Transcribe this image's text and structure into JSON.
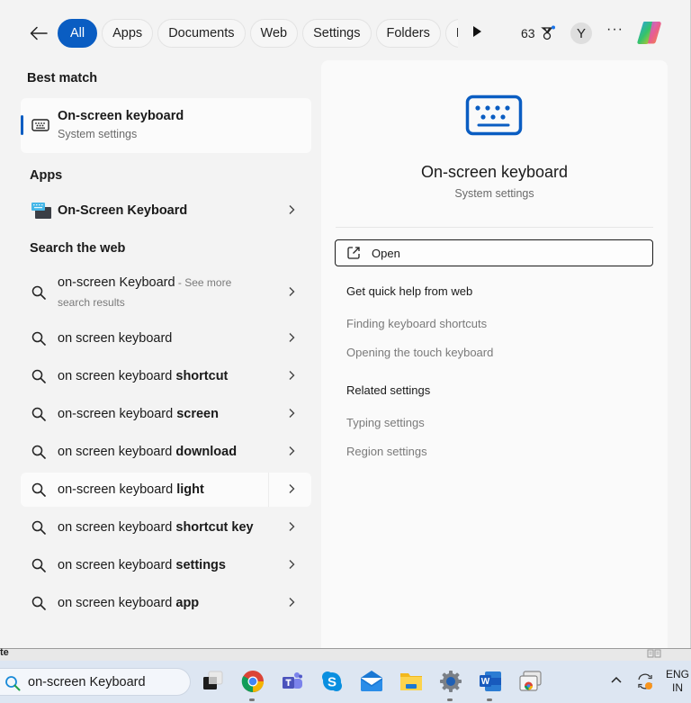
{
  "topbar": {
    "filters": [
      {
        "label": "All",
        "active": true
      },
      {
        "label": "Apps"
      },
      {
        "label": "Documents"
      },
      {
        "label": "Web"
      },
      {
        "label": "Settings"
      },
      {
        "label": "Folders"
      },
      {
        "label": "Photos"
      }
    ],
    "filters_visible_last": "Pho",
    "rewards_points": "63",
    "avatar_initial": "Y",
    "more_label": "···"
  },
  "left": {
    "best_match_title": "Best match",
    "best_match": {
      "title": "On-screen keyboard",
      "subtitle": "System settings"
    },
    "apps_title": "Apps",
    "apps": [
      {
        "label": "On-Screen Keyboard"
      }
    ],
    "web_title": "Search the web",
    "web_first": {
      "query": "on-screen Keyboard",
      "suffix": " - See more",
      "subline": "search results"
    },
    "web_suggestions": [
      {
        "prefix": "on screen keyboard",
        "bold": ""
      },
      {
        "prefix": "on screen keyboard ",
        "bold": "shortcut"
      },
      {
        "prefix": "on-screen keyboard ",
        "bold": "screen"
      },
      {
        "prefix": "on screen keyboard ",
        "bold": "download"
      },
      {
        "prefix": "on-screen keyboard ",
        "bold": "light"
      },
      {
        "prefix": "on screen keyboard ",
        "bold": "shortcut key"
      },
      {
        "prefix": "on screen keyboard ",
        "bold": "settings"
      },
      {
        "prefix": "on screen keyboard ",
        "bold": "app"
      }
    ]
  },
  "right": {
    "title": "On-screen keyboard",
    "subtitle": "System settings",
    "open_label": "Open",
    "help_title": "Get quick help from web",
    "help_links": [
      "Finding keyboard shortcuts",
      "Opening the touch keyboard"
    ],
    "related_title": "Related settings",
    "related_links": [
      "Typing settings",
      "Region settings"
    ]
  },
  "background": {
    "fragment": "te"
  },
  "taskbar": {
    "search_value": "on-screen Keyboard",
    "apps": [
      "Task View",
      "Google Chrome",
      "Microsoft Teams",
      "Skype",
      "Mail",
      "File Explorer",
      "Settings",
      "Microsoft Word",
      "Chrome Apps"
    ],
    "lang_line1": "ENG",
    "lang_line2": "IN"
  },
  "colors": {
    "accent": "#0a5dc2",
    "background": "#f3f3f3",
    "panel": "#fafafa"
  }
}
